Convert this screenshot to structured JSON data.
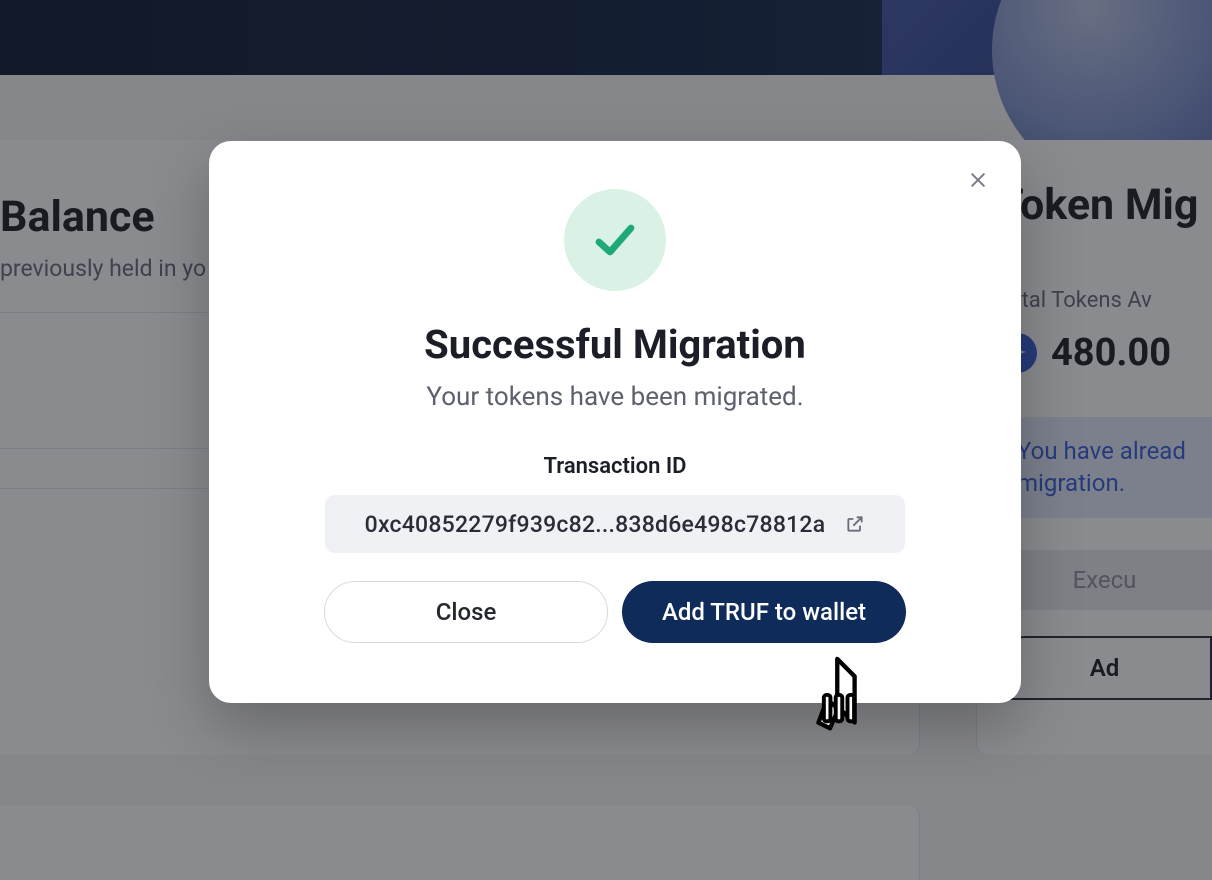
{
  "background": {
    "left_card": {
      "title": "Balance",
      "subtitle_fragment": "previously held in yo"
    },
    "right_card": {
      "title_fragment": "Token Mig",
      "total_label_fragment": "Total Tokens Av",
      "amount": "480.00",
      "info_line1_fragment": "You have alread",
      "info_line2": "migration.",
      "status_fragment": "Execu",
      "add_fragment": "Ad"
    }
  },
  "modal": {
    "title": "Successful Migration",
    "subtitle": "Your tokens have been migrated.",
    "txid_label": "Transaction ID",
    "txid_value": "0xc40852279f939c82...838d6e498c78812a",
    "close_button": "Close",
    "primary_button": "Add TRUF to wallet"
  }
}
